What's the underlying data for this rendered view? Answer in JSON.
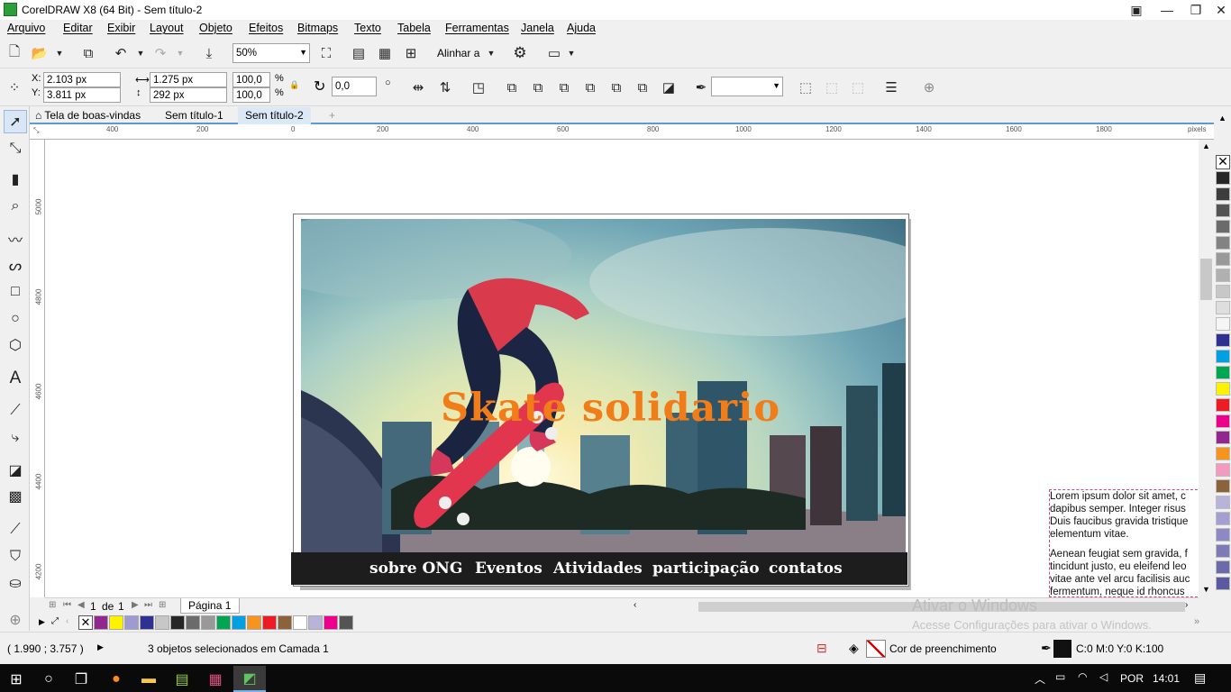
{
  "window": {
    "title": "CorelDRAW X8 (64 Bit) - Sem título-2"
  },
  "menu": [
    "Arquivo",
    "Editar",
    "Exibir",
    "Layout",
    "Objeto",
    "Efeitos",
    "Bitmaps",
    "Texto",
    "Tabela",
    "Ferramentas",
    "Janela",
    "Ajuda"
  ],
  "toolbar": {
    "zoom": "50%",
    "align_label": "Alinhar a"
  },
  "props": {
    "x_label": "X:",
    "x": "2.103 px",
    "y_label": "Y:",
    "y": "3.811 px",
    "w": "1.275 px",
    "h": "292 px",
    "sx": "100,0",
    "sy": "100,0",
    "pct": "%",
    "rotation": "0,0"
  },
  "tabs": [
    "Tela de boas-vindas",
    "Sem título-1",
    "Sem título-2"
  ],
  "ruler": {
    "top": [
      "400",
      "200",
      "0",
      "200",
      "400",
      "600",
      "800",
      "1000",
      "1200",
      "1400",
      "1600",
      "1800"
    ],
    "unit": "pixels",
    "left": [
      "5000",
      "4800",
      "4600",
      "4400",
      "4200"
    ]
  },
  "design": {
    "title": "Skate solidario",
    "nav": [
      "sobre ONG",
      "Eventos",
      "Atividades",
      "participação",
      "contatos"
    ],
    "lorem_p1": [
      "Lorem ipsum dolor sit amet, c",
      "dapibus semper. Integer risus",
      "Duis faucibus gravida tristique",
      "elementum vitae."
    ],
    "lorem_p2": [
      "Aenean feugiat sem gravida, f",
      "tincidunt justo, eu eleifend leo",
      "vitae ante vel arcu facilisis auc",
      "fermentum, neque id rhoncus"
    ]
  },
  "pager": {
    "current": "1",
    "of": "de",
    "total": "1",
    "page_tab": "Página 1"
  },
  "watermark": {
    "line1": "Ativar o Windows",
    "line2": "Acesse Configurações para ativar o Windows."
  },
  "status": {
    "coords": "( 1.990 ; 3.757 )",
    "selection": "3 objetos selecionados em Camada 1",
    "fill_label": "Cor de preenchimento",
    "outline": "C:0 M:0 Y:0 K:100"
  },
  "taskbar": {
    "lang": "POR",
    "time": "14:01"
  },
  "palette_right": [
    "#262626",
    "#3d3d3d",
    "#545454",
    "#6b6b6b",
    "#828282",
    "#999999",
    "#b0b0b0",
    "#c7c7c7",
    "#dedede",
    "#f5f5f5",
    "#2e3192",
    "#00a0e3",
    "#00a651",
    "#fff200",
    "#ed1c24",
    "#ec008c",
    "#92278f",
    "#f7941d",
    "#f49ac1",
    "#8c6239",
    "#b7b3d9",
    "#a3a0d1",
    "#8c89c4",
    "#7c7ab7",
    "#6c6aab",
    "#5b5aa0"
  ],
  "palette_bottom": [
    "#92278f",
    "#fff200",
    "#9e9bd1",
    "#2e3192",
    "#c7c7c7",
    "#262626",
    "#6b6b6b",
    "#999999",
    "#00a651",
    "#00a0e3",
    "#f7941d",
    "#ed1c24",
    "#8c6239",
    "#ffffff",
    "#b7b3d9",
    "#ec008c",
    "#545454"
  ]
}
